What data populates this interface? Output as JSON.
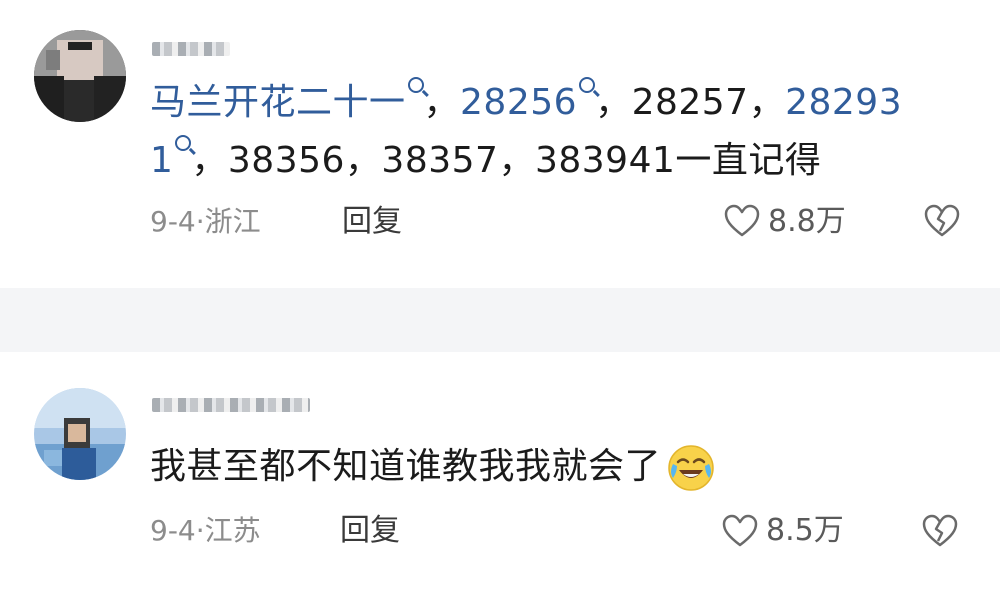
{
  "comments": [
    {
      "author_name": "一川",
      "text_prefix": "马兰开花二十一",
      "text_line1_after_link1": "，",
      "link2": "28256",
      "text_line1_after_link2": "，28257，",
      "link3": "28293",
      "link3_tail": "1",
      "text_line2_rest": "，38356，38357，383941一直记得",
      "date": "9-4",
      "location": "浙江",
      "reply_label": "回复",
      "like_count": "8.8万"
    },
    {
      "author_name": "",
      "text": "我甚至都不知道谁教我我就会了",
      "emoji": "crying-laughing-emoji",
      "date": "9-4",
      "location": "江苏",
      "reply_label": "回复",
      "like_count": "8.5万"
    }
  ],
  "icons": {
    "like": "heart-outline-icon",
    "dislike": "broken-heart-icon",
    "search": "search-magnifier-icon"
  },
  "colors": {
    "link": "#315d9b",
    "meta": "#8c8c8c",
    "text": "#1b1b1b"
  }
}
